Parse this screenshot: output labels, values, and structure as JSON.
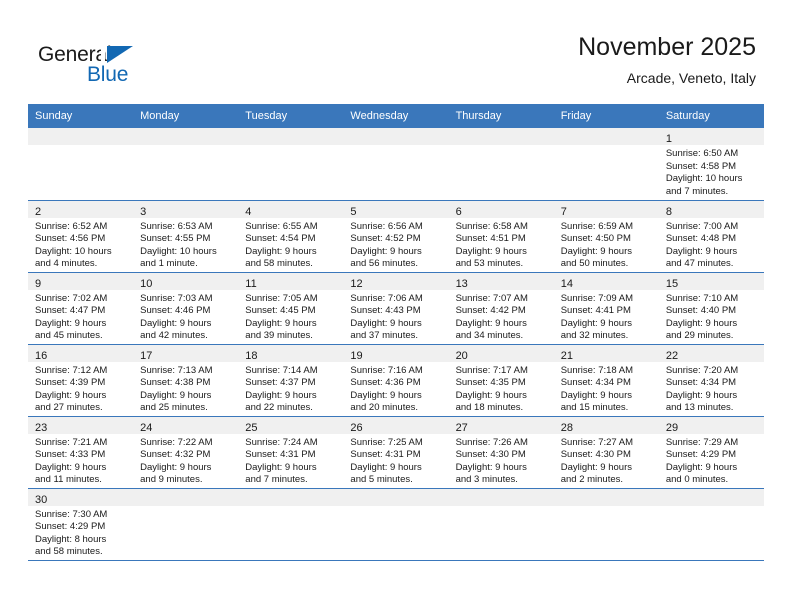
{
  "brand": {
    "name_part1": "General",
    "name_part2": "Blue",
    "accent_color": "#1268b3"
  },
  "header": {
    "title": "November 2025",
    "subtitle": "Arcade, Veneto, Italy",
    "header_bg": "#3a77bb"
  },
  "weekdays": [
    "Sunday",
    "Monday",
    "Tuesday",
    "Wednesday",
    "Thursday",
    "Friday",
    "Saturday"
  ],
  "labels": {
    "sunrise": "Sunrise:",
    "sunset": "Sunset:",
    "daylight": "Daylight:"
  },
  "weeks": [
    [
      {
        "empty": true
      },
      {
        "empty": true
      },
      {
        "empty": true
      },
      {
        "empty": true
      },
      {
        "empty": true
      },
      {
        "empty": true
      },
      {
        "day": "1",
        "sunrise": "Sunrise: 6:50 AM",
        "sunset": "Sunset: 4:58 PM",
        "daylight_1": "Daylight: 10 hours",
        "daylight_2": "and 7 minutes."
      }
    ],
    [
      {
        "day": "2",
        "sunrise": "Sunrise: 6:52 AM",
        "sunset": "Sunset: 4:56 PM",
        "daylight_1": "Daylight: 10 hours",
        "daylight_2": "and 4 minutes."
      },
      {
        "day": "3",
        "sunrise": "Sunrise: 6:53 AM",
        "sunset": "Sunset: 4:55 PM",
        "daylight_1": "Daylight: 10 hours",
        "daylight_2": "and 1 minute."
      },
      {
        "day": "4",
        "sunrise": "Sunrise: 6:55 AM",
        "sunset": "Sunset: 4:54 PM",
        "daylight_1": "Daylight: 9 hours",
        "daylight_2": "and 58 minutes."
      },
      {
        "day": "5",
        "sunrise": "Sunrise: 6:56 AM",
        "sunset": "Sunset: 4:52 PM",
        "daylight_1": "Daylight: 9 hours",
        "daylight_2": "and 56 minutes."
      },
      {
        "day": "6",
        "sunrise": "Sunrise: 6:58 AM",
        "sunset": "Sunset: 4:51 PM",
        "daylight_1": "Daylight: 9 hours",
        "daylight_2": "and 53 minutes."
      },
      {
        "day": "7",
        "sunrise": "Sunrise: 6:59 AM",
        "sunset": "Sunset: 4:50 PM",
        "daylight_1": "Daylight: 9 hours",
        "daylight_2": "and 50 minutes."
      },
      {
        "day": "8",
        "sunrise": "Sunrise: 7:00 AM",
        "sunset": "Sunset: 4:48 PM",
        "daylight_1": "Daylight: 9 hours",
        "daylight_2": "and 47 minutes."
      }
    ],
    [
      {
        "day": "9",
        "sunrise": "Sunrise: 7:02 AM",
        "sunset": "Sunset: 4:47 PM",
        "daylight_1": "Daylight: 9 hours",
        "daylight_2": "and 45 minutes."
      },
      {
        "day": "10",
        "sunrise": "Sunrise: 7:03 AM",
        "sunset": "Sunset: 4:46 PM",
        "daylight_1": "Daylight: 9 hours",
        "daylight_2": "and 42 minutes."
      },
      {
        "day": "11",
        "sunrise": "Sunrise: 7:05 AM",
        "sunset": "Sunset: 4:45 PM",
        "daylight_1": "Daylight: 9 hours",
        "daylight_2": "and 39 minutes."
      },
      {
        "day": "12",
        "sunrise": "Sunrise: 7:06 AM",
        "sunset": "Sunset: 4:43 PM",
        "daylight_1": "Daylight: 9 hours",
        "daylight_2": "and 37 minutes."
      },
      {
        "day": "13",
        "sunrise": "Sunrise: 7:07 AM",
        "sunset": "Sunset: 4:42 PM",
        "daylight_1": "Daylight: 9 hours",
        "daylight_2": "and 34 minutes."
      },
      {
        "day": "14",
        "sunrise": "Sunrise: 7:09 AM",
        "sunset": "Sunset: 4:41 PM",
        "daylight_1": "Daylight: 9 hours",
        "daylight_2": "and 32 minutes."
      },
      {
        "day": "15",
        "sunrise": "Sunrise: 7:10 AM",
        "sunset": "Sunset: 4:40 PM",
        "daylight_1": "Daylight: 9 hours",
        "daylight_2": "and 29 minutes."
      }
    ],
    [
      {
        "day": "16",
        "sunrise": "Sunrise: 7:12 AM",
        "sunset": "Sunset: 4:39 PM",
        "daylight_1": "Daylight: 9 hours",
        "daylight_2": "and 27 minutes."
      },
      {
        "day": "17",
        "sunrise": "Sunrise: 7:13 AM",
        "sunset": "Sunset: 4:38 PM",
        "daylight_1": "Daylight: 9 hours",
        "daylight_2": "and 25 minutes."
      },
      {
        "day": "18",
        "sunrise": "Sunrise: 7:14 AM",
        "sunset": "Sunset: 4:37 PM",
        "daylight_1": "Daylight: 9 hours",
        "daylight_2": "and 22 minutes."
      },
      {
        "day": "19",
        "sunrise": "Sunrise: 7:16 AM",
        "sunset": "Sunset: 4:36 PM",
        "daylight_1": "Daylight: 9 hours",
        "daylight_2": "and 20 minutes."
      },
      {
        "day": "20",
        "sunrise": "Sunrise: 7:17 AM",
        "sunset": "Sunset: 4:35 PM",
        "daylight_1": "Daylight: 9 hours",
        "daylight_2": "and 18 minutes."
      },
      {
        "day": "21",
        "sunrise": "Sunrise: 7:18 AM",
        "sunset": "Sunset: 4:34 PM",
        "daylight_1": "Daylight: 9 hours",
        "daylight_2": "and 15 minutes."
      },
      {
        "day": "22",
        "sunrise": "Sunrise: 7:20 AM",
        "sunset": "Sunset: 4:34 PM",
        "daylight_1": "Daylight: 9 hours",
        "daylight_2": "and 13 minutes."
      }
    ],
    [
      {
        "day": "23",
        "sunrise": "Sunrise: 7:21 AM",
        "sunset": "Sunset: 4:33 PM",
        "daylight_1": "Daylight: 9 hours",
        "daylight_2": "and 11 minutes."
      },
      {
        "day": "24",
        "sunrise": "Sunrise: 7:22 AM",
        "sunset": "Sunset: 4:32 PM",
        "daylight_1": "Daylight: 9 hours",
        "daylight_2": "and 9 minutes."
      },
      {
        "day": "25",
        "sunrise": "Sunrise: 7:24 AM",
        "sunset": "Sunset: 4:31 PM",
        "daylight_1": "Daylight: 9 hours",
        "daylight_2": "and 7 minutes."
      },
      {
        "day": "26",
        "sunrise": "Sunrise: 7:25 AM",
        "sunset": "Sunset: 4:31 PM",
        "daylight_1": "Daylight: 9 hours",
        "daylight_2": "and 5 minutes."
      },
      {
        "day": "27",
        "sunrise": "Sunrise: 7:26 AM",
        "sunset": "Sunset: 4:30 PM",
        "daylight_1": "Daylight: 9 hours",
        "daylight_2": "and 3 minutes."
      },
      {
        "day": "28",
        "sunrise": "Sunrise: 7:27 AM",
        "sunset": "Sunset: 4:30 PM",
        "daylight_1": "Daylight: 9 hours",
        "daylight_2": "and 2 minutes."
      },
      {
        "day": "29",
        "sunrise": "Sunrise: 7:29 AM",
        "sunset": "Sunset: 4:29 PM",
        "daylight_1": "Daylight: 9 hours",
        "daylight_2": "and 0 minutes."
      }
    ],
    [
      {
        "day": "30",
        "sunrise": "Sunrise: 7:30 AM",
        "sunset": "Sunset: 4:29 PM",
        "daylight_1": "Daylight: 8 hours",
        "daylight_2": "and 58 minutes."
      },
      {
        "empty": true
      },
      {
        "empty": true
      },
      {
        "empty": true
      },
      {
        "empty": true
      },
      {
        "empty": true
      },
      {
        "empty": true
      }
    ]
  ]
}
